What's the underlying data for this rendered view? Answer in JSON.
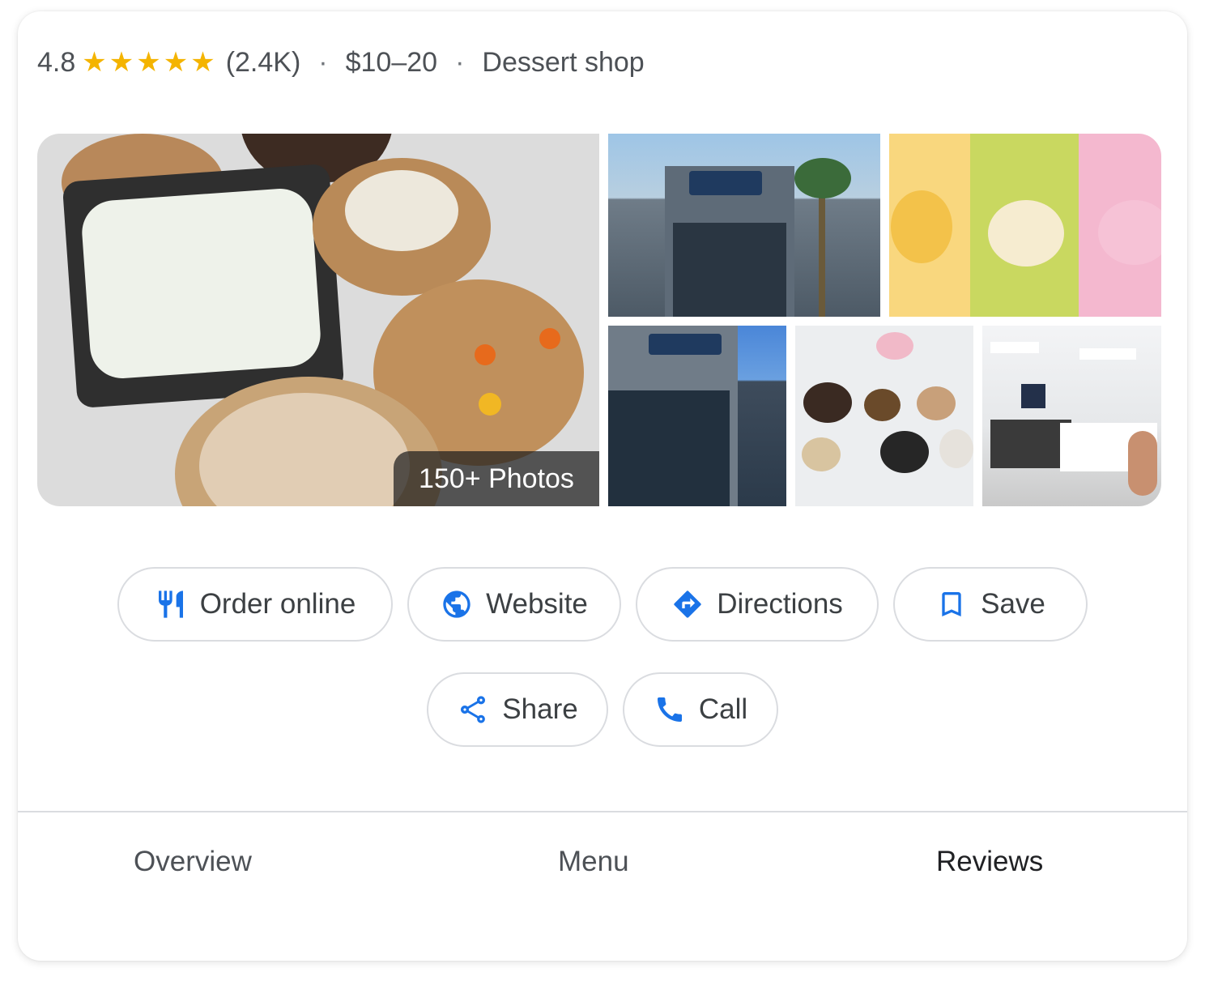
{
  "summary": {
    "rating": "4.8",
    "stars_filled": 5,
    "review_count": "(2.4K)",
    "separator": "·",
    "price": "$10–20",
    "category": "Dessert shop",
    "star_color": "#f4b400"
  },
  "photos": {
    "count_label": "150+ Photos"
  },
  "actions": {
    "order_online": "Order online",
    "website": "Website",
    "directions": "Directions",
    "save": "Save",
    "share": "Share",
    "call": "Call",
    "accent_color": "#1a73e8"
  },
  "tabs": {
    "overview": "Overview",
    "menu": "Menu",
    "reviews": "Reviews"
  }
}
